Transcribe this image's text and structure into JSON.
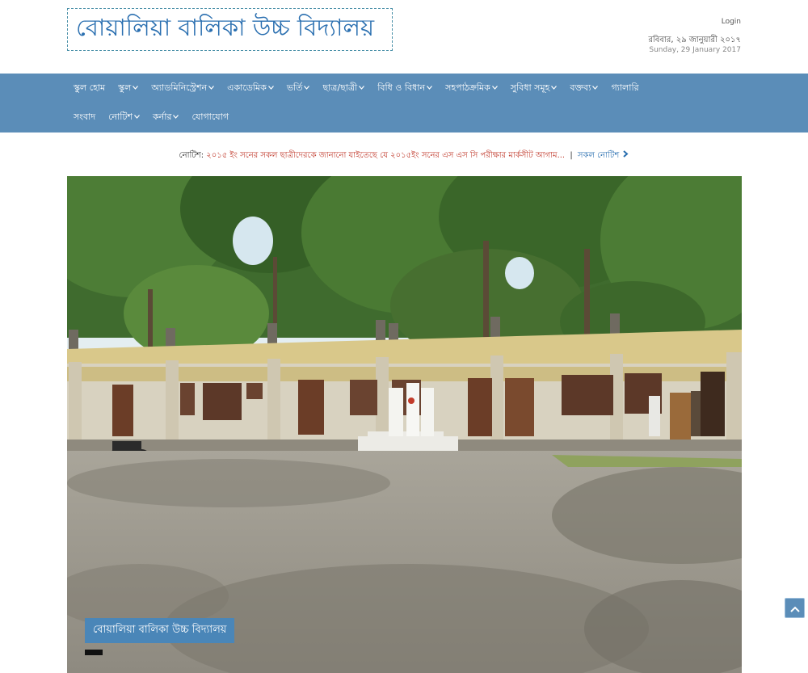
{
  "header": {
    "site_title": "বোয়ালিয়া বালিকা উচ্চ বিদ্যালয়",
    "login": "Login",
    "date_bn": "রবিবার, ২৯ জানুয়ারী ২০১৭",
    "date_en": "Sunday, 29 January 2017"
  },
  "nav": {
    "row1": [
      {
        "label": "স্কুল হোম",
        "dropdown": false
      },
      {
        "label": "স্কুল",
        "dropdown": true
      },
      {
        "label": "অ্যাডমিনিস্ট্রেশন",
        "dropdown": true
      },
      {
        "label": "একাডেমিক",
        "dropdown": true
      },
      {
        "label": "ভর্তি",
        "dropdown": true
      },
      {
        "label": "ছাত্র/ছাত্রী",
        "dropdown": true
      },
      {
        "label": "বিধি ও বিধান",
        "dropdown": true
      },
      {
        "label": "সহপাঠক্রমিক",
        "dropdown": true
      },
      {
        "label": "সুবিধা সমূহ",
        "dropdown": true
      },
      {
        "label": "বক্তব্য",
        "dropdown": true
      },
      {
        "label": "গ্যালারি",
        "dropdown": false
      }
    ],
    "row2": [
      {
        "label": "সংবাদ",
        "dropdown": false
      },
      {
        "label": "নোটিশ",
        "dropdown": true
      },
      {
        "label": "কর্নার",
        "dropdown": true
      },
      {
        "label": "যোগাযোগ",
        "dropdown": false
      }
    ]
  },
  "notice": {
    "label": "নোটিশ:",
    "text": "২০১৫ ইং সনের সকল ছাত্রীদেরকে জানানো যাইতেছে যে ২০১৫ইং সনের এস এস সি পরীক্ষার মার্কসীট আগাম...",
    "separator": "|",
    "all_link": "সকল নোটিশ"
  },
  "slider": {
    "caption": "বোয়ালিয়া বালিকা উচ্চ বিদ্যালয়"
  },
  "icons": {
    "caret": "chevron-down-icon",
    "notice_arrow": "chevron-right-icon",
    "scroll_top": "arrow-up-icon"
  },
  "colors": {
    "nav_bg": "#5b8db8",
    "title_blue": "#2a6fb0",
    "notice_red": "#c0392b",
    "caption_bg": "#4a86b8"
  }
}
